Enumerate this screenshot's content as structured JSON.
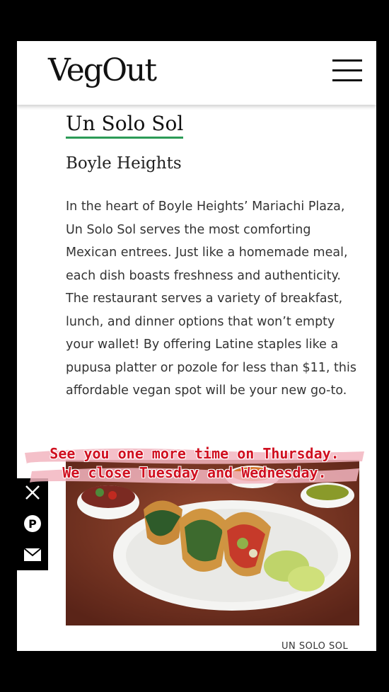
{
  "header": {
    "logo": "VegOut"
  },
  "article": {
    "title": "Un Solo Sol",
    "subtitle": "Boyle Heights",
    "body": "In the heart of Boyle Heights’ Mariachi Plaza, Un Solo Sol serves the most comforting Mexican entrees. Just like a homemade meal, each dish boasts freshness and authenticity. The restaurant serves a variety of breakfast, lunch, and dinner options that won’t empty your wallet! By offering Latine staples like a pupusa platter or pozole for less than $11, this affordable vegan spot will be your new go-to.",
    "caption": "UN SOLO SOL"
  },
  "banner": {
    "line1": "See you one more time on Thursday.",
    "line2": "We close Tuesday and Wednesday."
  },
  "social": [
    "x-icon",
    "pinterest-icon",
    "email-icon"
  ],
  "colors": {
    "accent_underline": "#2c9b57",
    "banner_text": "#d01020",
    "banner_brush": "#f2b5bf"
  }
}
